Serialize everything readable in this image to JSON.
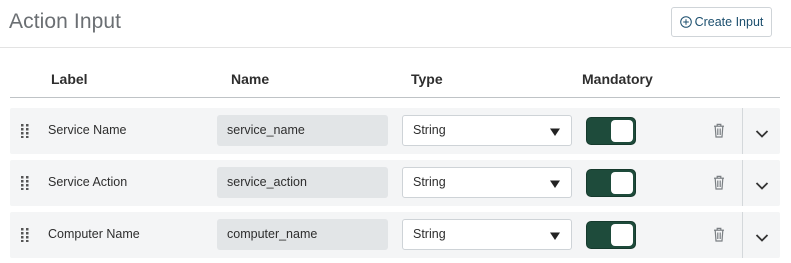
{
  "header": {
    "title": "Action Input",
    "create_button_label": "Create Input"
  },
  "columns": {
    "label": "Label",
    "name": "Name",
    "type": "Type",
    "mandatory": "Mandatory"
  },
  "rows": [
    {
      "label": "Service Name",
      "name": "service_name",
      "type": "String",
      "mandatory": true
    },
    {
      "label": "Service Action",
      "name": "service_action",
      "type": "String",
      "mandatory": true
    },
    {
      "label": "Computer Name",
      "name": "computer_name",
      "type": "String",
      "mandatory": true
    }
  ],
  "icons": {
    "create": "plus-circle-icon",
    "drag": "drag-handle-icon",
    "type_dropdown": "caret-down-icon",
    "delete": "trash-icon",
    "expand": "chevron-down-icon"
  },
  "colors": {
    "toggle_on": "#1e4b3b",
    "button_text": "#1c4f6e",
    "title": "#6b6f73"
  }
}
